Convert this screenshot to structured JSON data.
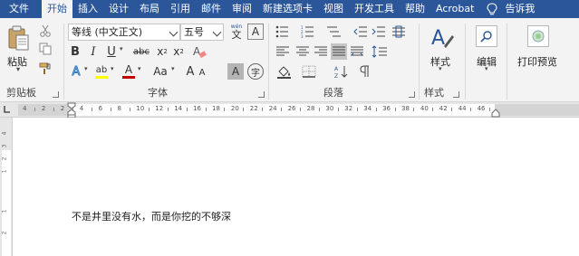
{
  "menu": {
    "items": [
      "文件",
      "开始",
      "插入",
      "设计",
      "布局",
      "引用",
      "邮件",
      "审阅",
      "新建选项卡",
      "视图",
      "开发工具",
      "帮助",
      "Acrobat"
    ],
    "active": "开始",
    "tell_me": "告诉我"
  },
  "ribbon": {
    "clipboard": {
      "label": "剪贴板",
      "paste": "粘贴"
    },
    "font": {
      "label": "字体",
      "font_name": "等线 (中文正文)",
      "font_size": "五号",
      "wen_label": "wén",
      "wen_char": "文",
      "bold": "B",
      "italic": "I",
      "underline": "U",
      "strike": "abc",
      "subscript": "x",
      "sub_mark": "2",
      "superscript": "x",
      "sup_mark": "2",
      "clear": "A",
      "text_effect": "A",
      "highlight": "ab",
      "font_color": "A",
      "change_case": "Aa",
      "grow": "A",
      "shrink": "A",
      "char_shade": "A",
      "enclose": "字"
    },
    "paragraph": {
      "label": "段落"
    },
    "styles": {
      "label": "样式",
      "styles_btn": "样式"
    },
    "editing": {
      "edit_btn": "编辑"
    },
    "print_preview": {
      "btn": "打印预览"
    }
  },
  "ruler": {
    "numbers": [
      "4",
      "2",
      "2",
      "4",
      "6",
      "8",
      "10",
      "12",
      "14",
      "16",
      "18",
      "20",
      "22",
      "24",
      "26",
      "28",
      "30",
      "32",
      "34",
      "36",
      "38",
      "40",
      "42",
      "44",
      "46"
    ]
  },
  "vruler": {
    "numbers": [
      "4",
      "3",
      "2",
      "1",
      "1",
      "2"
    ]
  },
  "document": {
    "text": "不是井里没有水，而是你挖的不够深"
  },
  "colors": {
    "accent": "#2b579a",
    "highlight": "#ffff00",
    "font_color": "#c00000"
  }
}
